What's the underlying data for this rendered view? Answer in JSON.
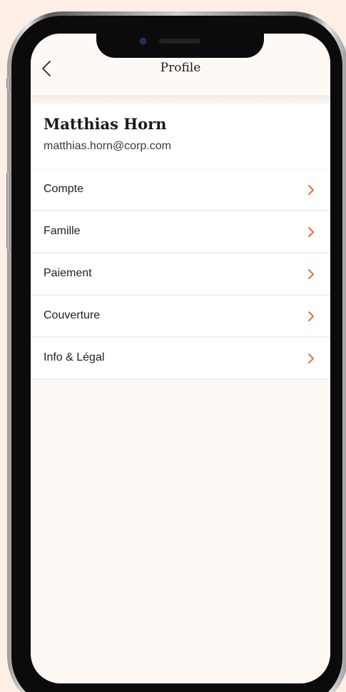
{
  "header": {
    "title": "Profile",
    "back_icon": "chevron-left-icon"
  },
  "profile": {
    "name": "Matthias Horn",
    "email": "matthias.horn@corp.com"
  },
  "menu": {
    "items": [
      {
        "label": "Compte"
      },
      {
        "label": "Famille"
      },
      {
        "label": "Paiement"
      },
      {
        "label": "Couverture"
      },
      {
        "label": "Info & Légal"
      }
    ],
    "chevron_icon": "chevron-right-icon"
  },
  "colors": {
    "background": "#fdefe6",
    "screen": "#fef9f5",
    "accent": "#e0703d",
    "text": "#1f1f1f"
  }
}
